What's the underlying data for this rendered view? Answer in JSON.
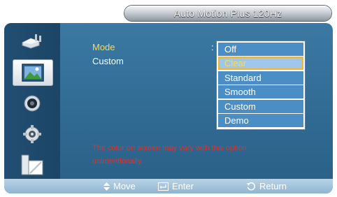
{
  "title": "Auto Motion Plus 120Hz",
  "sidebar": {
    "items": [
      {
        "icon": "input-plug-icon"
      },
      {
        "icon": "picture-icon",
        "active": true
      },
      {
        "icon": "sound-icon"
      },
      {
        "icon": "setup-gear-icon"
      },
      {
        "icon": "multi-control-icon"
      }
    ]
  },
  "menu": {
    "mode_label": "Mode",
    "custom_label": "Custom",
    "colon": ":"
  },
  "dropdown": {
    "options": [
      "Off",
      "Clear",
      "Standard",
      "Smooth",
      "Custom",
      "Demo"
    ],
    "selected": "Clear"
  },
  "warning": "The color on screen may vary with this option unintentionally",
  "footer": {
    "move": "Move",
    "enter": "Enter",
    "return": "Return"
  },
  "colors": {
    "frame_blue": "#2f6991",
    "highlight_yellow": "#ffd94a",
    "warning_red": "#e0322a",
    "option_blue": "#4b8ec6"
  }
}
